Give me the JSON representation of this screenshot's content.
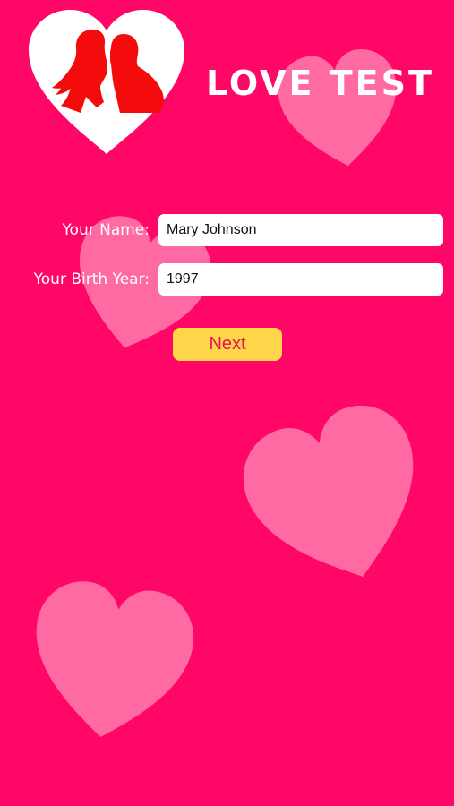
{
  "app": {
    "title": "LOVE TEST",
    "logo_icon": "heart-couple-silhouette-icon"
  },
  "form": {
    "name_label": "Your Name:",
    "name_value": "Mary Johnson",
    "birth_year_label": "Your Birth Year:",
    "birth_year_value": "1997",
    "next_label": "Next"
  },
  "colors": {
    "background": "#ff0766",
    "decor_heart": "#ff6aa2",
    "button": "#ffd54a",
    "button_text": "#e2164f",
    "logo_silhouette": "#f40b0b"
  }
}
